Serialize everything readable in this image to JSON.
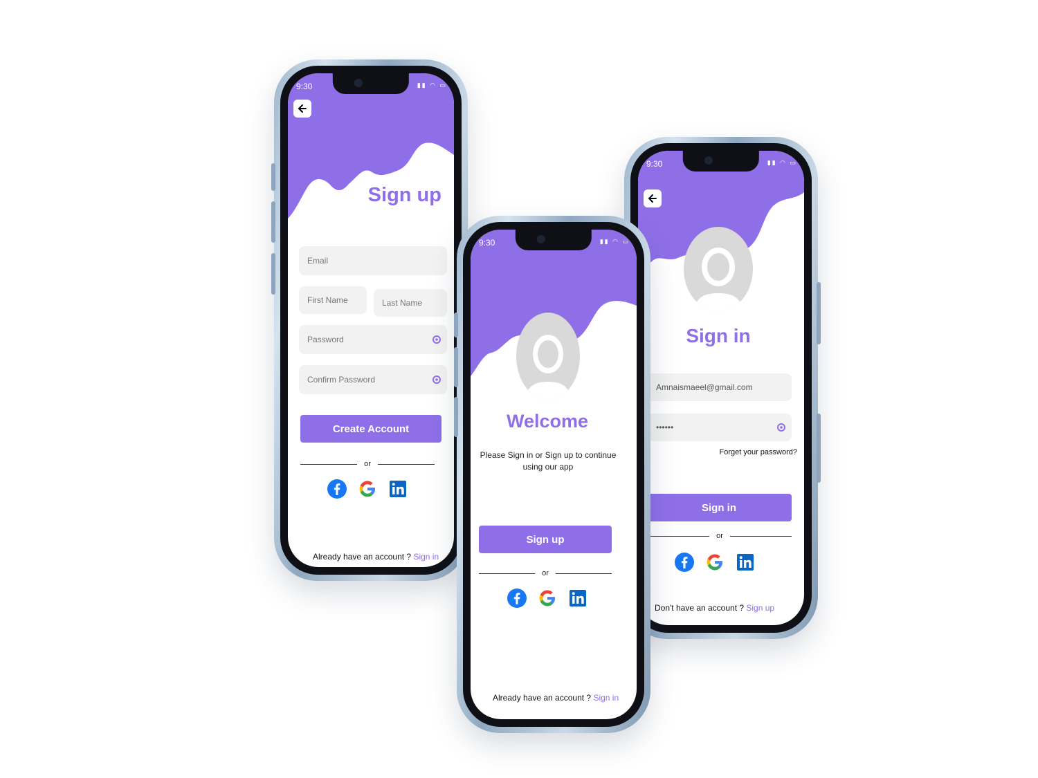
{
  "colors": {
    "accent": "#8f6fe8",
    "link": "#8f6fe8",
    "field_bg": "#f2f2f2"
  },
  "status_bar": {
    "time": "9:30"
  },
  "signup_screen": {
    "title": "Sign up",
    "email_placeholder": "Email",
    "first_name_placeholder": "First Name",
    "last_name_placeholder": "Last Name",
    "password_placeholder": "Password",
    "confirm_password_placeholder": "Confirm Password",
    "create_button": "Create Account",
    "divider": "or",
    "footer_text": "Already have an account ?",
    "footer_link": "Sign in"
  },
  "welcome_screen": {
    "title": "Welcome",
    "subtitle_line1": "Please Sign in or Sign up to continue",
    "subtitle_line2": "using our app",
    "signup_button": "Sign up",
    "divider": "or",
    "footer_text": "Already have an account ?",
    "footer_link": "Sign in"
  },
  "signin_screen": {
    "title": "Sign in",
    "email_value": "Amnaismaeel@gmail.com",
    "password_value": "••••••",
    "forgot_link": "Forget your password?",
    "signin_button": "Sign in",
    "divider": "or",
    "footer_text": "Don't have an account ?",
    "footer_link": "Sign up"
  },
  "social_icons": [
    "facebook-icon",
    "google-icon",
    "linkedin-icon"
  ]
}
